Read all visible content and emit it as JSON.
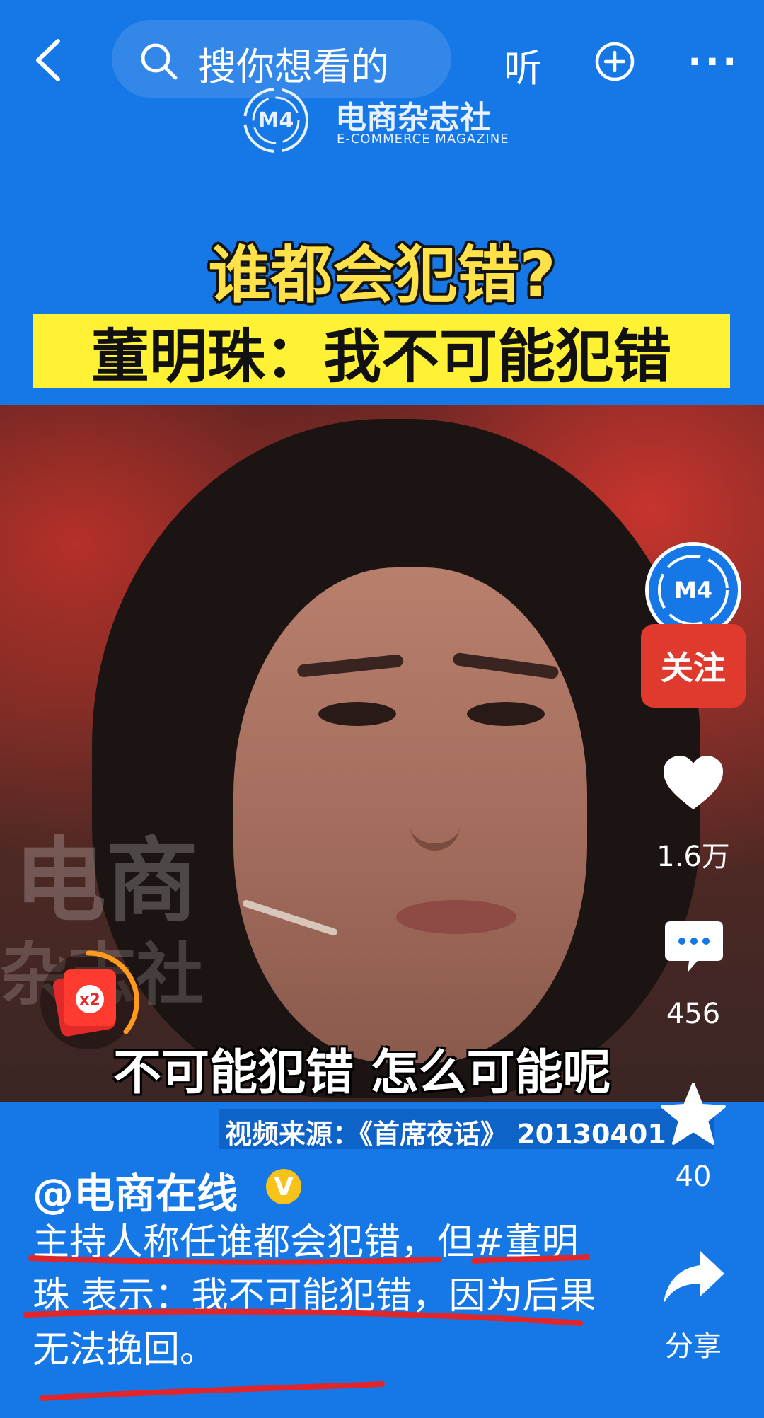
{
  "topbar": {
    "search_placeholder": "搜你想看的",
    "listen_label": "听"
  },
  "logo": {
    "name": "电商杂志社",
    "subtitle": "E-COMMERCE MAGAZINE"
  },
  "video": {
    "headline": "谁都会犯错?",
    "banner": "董明珠：我不可能犯错",
    "watermark_line1": "电商",
    "watermark_line2": "杂志社",
    "subtitle": "不可能犯错 怎么可能呢",
    "source": "视频来源：《首席夜话》 20130401",
    "red_packet_badge": "x2"
  },
  "actions": {
    "follow_label": "关注",
    "like_count": "1.6万",
    "comment_count": "456",
    "favorite_count": "40",
    "share_label": "分享"
  },
  "post": {
    "author": "@电商在线",
    "verified_badge": "V",
    "caption": "主持人称任谁都会犯错，但#董明珠 表示：我不可能犯错，因为后果无法挽回。"
  },
  "colors": {
    "background": "#1677e6",
    "follow": "#e0392d",
    "headline": "#ffe24a",
    "banner": "#fff234",
    "underline": "#e0262a"
  },
  "icons": [
    "back-arrow-icon",
    "search-icon",
    "plus-circle-icon",
    "more-icon",
    "heart-icon",
    "comment-icon",
    "star-icon",
    "share-icon",
    "red-packet-icon"
  ]
}
